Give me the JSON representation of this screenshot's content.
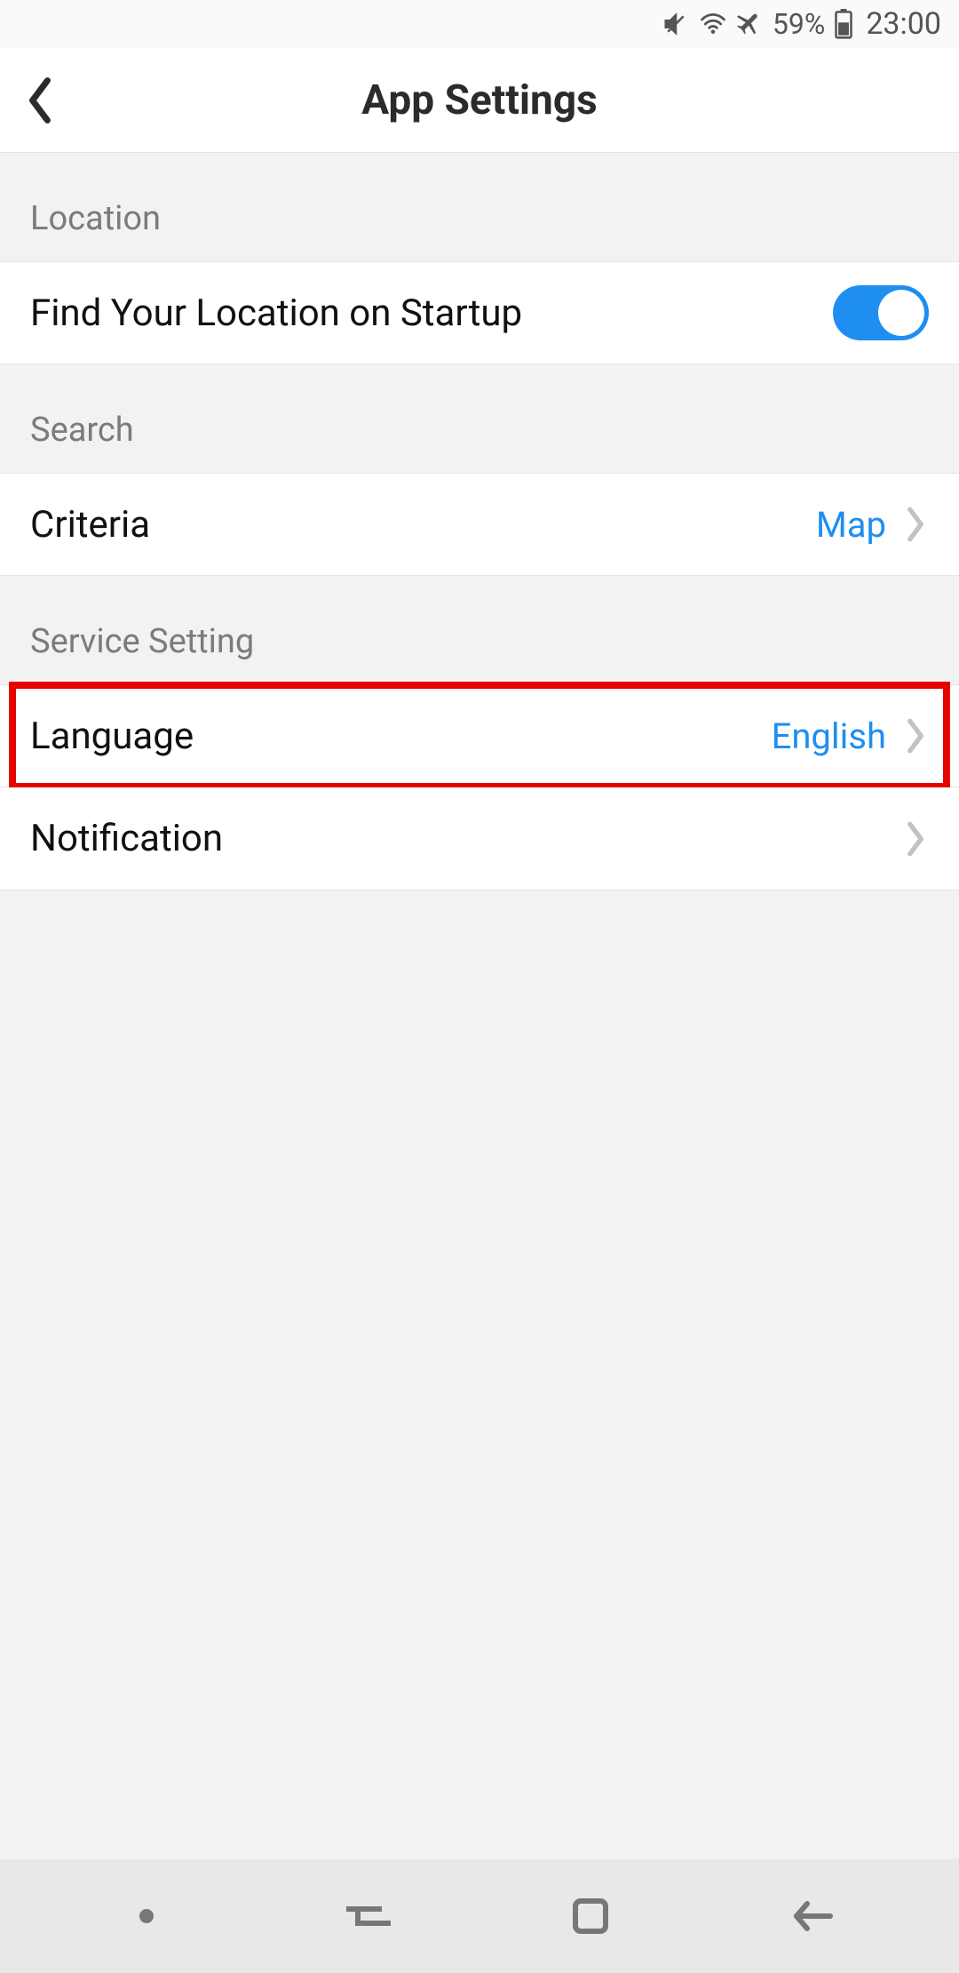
{
  "status": {
    "battery_pct": "59%",
    "time": "23:00"
  },
  "header": {
    "title": "App Settings"
  },
  "sections": {
    "location": {
      "header": "Location",
      "find_on_startup_label": "Find Your Location on Startup",
      "find_on_startup_on": true
    },
    "search": {
      "header": "Search",
      "criteria_label": "Criteria",
      "criteria_value": "Map"
    },
    "service": {
      "header": "Service Setting",
      "language_label": "Language",
      "language_value": "English",
      "notification_label": "Notification"
    }
  }
}
